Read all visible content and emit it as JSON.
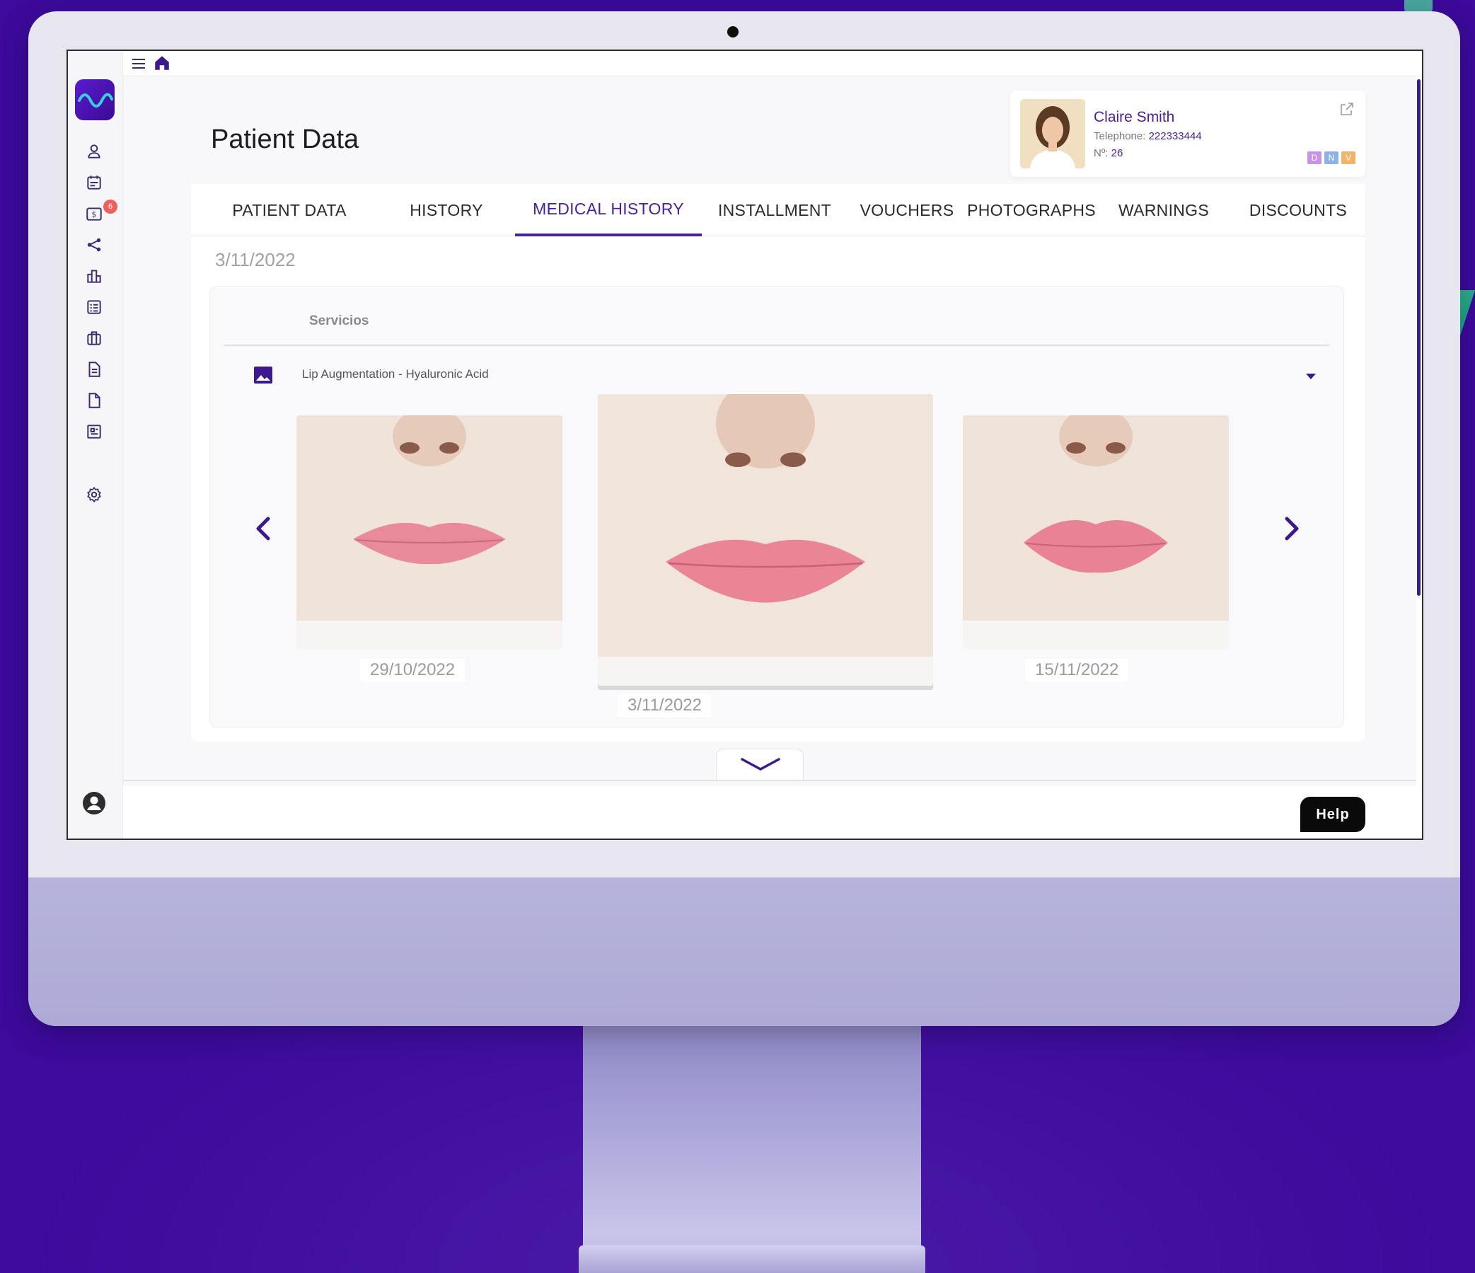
{
  "page": {
    "title": "Patient Data"
  },
  "patient": {
    "name": "Claire Smith",
    "telephone_label": "Telephone:",
    "telephone": "222333444",
    "number_label": "Nº:",
    "number": "26",
    "tags": [
      {
        "letter": "D",
        "color": "#c792e8"
      },
      {
        "letter": "N",
        "color": "#8fb2e6"
      },
      {
        "letter": "V",
        "color": "#f0b56a"
      }
    ]
  },
  "tabs": [
    {
      "label": "PATIENT DATA",
      "active": false
    },
    {
      "label": "HISTORY",
      "active": false
    },
    {
      "label": "MEDICAL HISTORY",
      "active": true
    },
    {
      "label": "INSTALLMENT",
      "active": false
    },
    {
      "label": "VOUCHERS",
      "active": false
    },
    {
      "label": "PHOTOGRAPHS",
      "active": false
    },
    {
      "label": "WARNINGS",
      "active": false
    },
    {
      "label": "DISCOUNTS",
      "active": false
    }
  ],
  "medical_history": {
    "date": "3/11/2022",
    "services_label": "Servicios",
    "service_name": "Lip Augmentation - Hyaluronic Acid",
    "photos": [
      {
        "date": "29/10/2022",
        "selected": false
      },
      {
        "date": "3/11/2022",
        "selected": true
      },
      {
        "date": "15/11/2022",
        "selected": false
      }
    ]
  },
  "sidebar": {
    "badge_count": "6",
    "icons": [
      "user-icon",
      "calendar-icon",
      "billing-icon",
      "share-icon",
      "stats-icon",
      "checklist-icon",
      "briefcase-icon",
      "document-icon",
      "file-icon",
      "report-icon",
      "settings-icon"
    ]
  },
  "help": {
    "label": "Help"
  },
  "colors": {
    "brand": "#4a1f9e",
    "background": "#3c0a9c",
    "badge": "#f0605a"
  }
}
